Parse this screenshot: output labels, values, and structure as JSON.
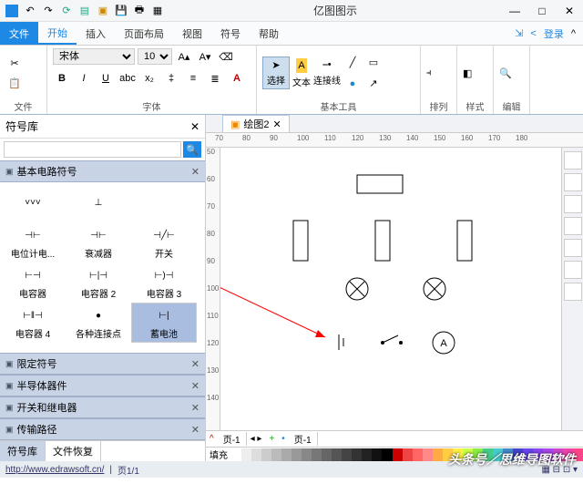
{
  "app": {
    "title": "亿图图示"
  },
  "qat": [
    "undo",
    "redo",
    "refresh",
    "new",
    "open",
    "save",
    "print",
    "grid"
  ],
  "win": {
    "min": "—",
    "max": "□",
    "close": "✕"
  },
  "tabs": {
    "file": "文件",
    "items": [
      "开始",
      "插入",
      "页面布局",
      "视图",
      "符号",
      "帮助"
    ],
    "active": 0,
    "login": "登录"
  },
  "ribbon": {
    "g1": "文件",
    "g2": {
      "label": "字体",
      "font": "宋体",
      "size": "10"
    },
    "g3": {
      "select": "选择",
      "text": "文本",
      "conn": "连接线",
      "label": "基本工具"
    },
    "g4": "排列",
    "g5": "样式",
    "g6": "编辑"
  },
  "left": {
    "title": "符号库",
    "sections": [
      "基本电路符号",
      "限定符号",
      "半导体器件",
      "开关和继电器",
      "传输路径"
    ],
    "symbols": [
      {
        "label": "",
        "glyph": "vvv"
      },
      {
        "label": "",
        "glyph": "t1"
      },
      {
        "label": "",
        "glyph": ""
      },
      {
        "label": "电位计电...",
        "glyph": "res"
      },
      {
        "label": "衰减器",
        "glyph": "cap"
      },
      {
        "label": "开关",
        "glyph": "sw"
      },
      {
        "label": "电容器",
        "glyph": "c1"
      },
      {
        "label": "电容器 2",
        "glyph": "c2"
      },
      {
        "label": "电容器 3",
        "glyph": "c3"
      },
      {
        "label": "电容器 4",
        "glyph": "c4"
      },
      {
        "label": "各种连接点",
        "glyph": "dot"
      },
      {
        "label": "蓄电池",
        "glyph": "bat",
        "sel": true
      },
      {
        "label": "",
        "glyph": "gnd"
      },
      {
        "label": "",
        "glyph": "gnd2"
      },
      {
        "label": "",
        "glyph": ""
      }
    ],
    "footer": [
      "符号库",
      "文件恢复"
    ]
  },
  "canvas": {
    "tab": "绘图2",
    "hruler": [
      70,
      80,
      90,
      100,
      110,
      120,
      130,
      140,
      150,
      160,
      170,
      180
    ],
    "vruler": [
      50,
      60,
      70,
      80,
      90,
      100,
      110,
      120,
      130,
      140
    ],
    "pagetab": "页-1",
    "pagetab2": "页-1",
    "fill": "填充"
  },
  "status": {
    "url": "http://www.edrawsoft.cn/",
    "page": "页1/1",
    "wm": "头条号／思维导图软件"
  },
  "colors": [
    "#fff",
    "#eee",
    "#ddd",
    "#ccc",
    "#bbb",
    "#aaa",
    "#999",
    "#888",
    "#777",
    "#666",
    "#555",
    "#444",
    "#333",
    "#222",
    "#111",
    "#000",
    "#c00",
    "#e44",
    "#f66",
    "#f88",
    "#fa4",
    "#fc4",
    "#fe4",
    "#cf4",
    "#8e4",
    "#4c8",
    "#4cc",
    "#48c",
    "#44c",
    "#64e",
    "#84e",
    "#a4e",
    "#c4c",
    "#e4a",
    "#f48"
  ]
}
